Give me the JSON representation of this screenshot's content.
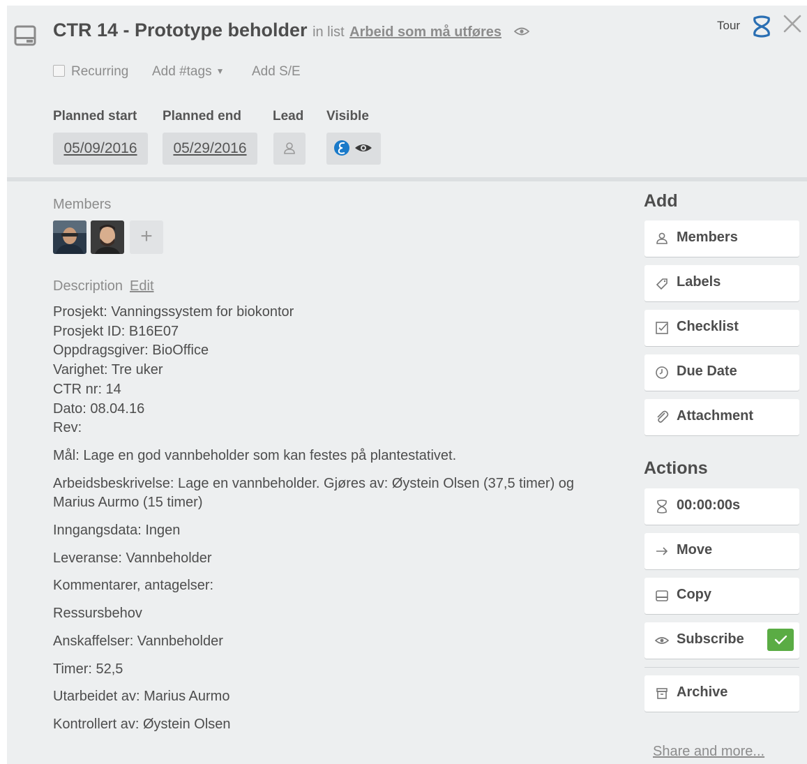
{
  "header": {
    "title": "CTR 14 - Prototype beholder",
    "in_list_prefix": "in list",
    "list_name": "Arbeid som må utføres",
    "tour_label": "Tour",
    "icons": {
      "card": "card-icon",
      "watch": "eye-icon",
      "tour": "tour-logo-icon",
      "close": "close-icon"
    },
    "recurring_label": "Recurring",
    "recurring_checked": false,
    "add_tags_label": "Add #tags",
    "add_se_label": "Add S/E"
  },
  "fields": {
    "planned_start_label": "Planned start",
    "planned_start_value": "05/09/2016",
    "planned_end_label": "Planned end",
    "planned_end_value": "05/29/2016",
    "lead_label": "Lead",
    "visible_label": "Visible"
  },
  "members": {
    "label": "Members",
    "avatars": [
      "member-avatar-1",
      "member-avatar-2"
    ],
    "add_label": "+"
  },
  "description": {
    "label": "Description",
    "edit_label": "Edit",
    "lines": [
      "Prosjekt: Vanningssystem for biokontor",
      "Prosjekt ID: B16E07",
      "Oppdragsgiver: BioOffice",
      "Varighet: Tre uker",
      "CTR nr: 14",
      "Dato: 08.04.16",
      "Rev:"
    ],
    "paragraphs": [
      "Mål: Lage en god vannbeholder som kan festes på plantestativet.",
      "Arbeidsbeskrivelse: Lage en vannbeholder. Gjøres av: Øystein Olsen (37,5 timer) og Marius Aurmo (15 timer)",
      "Inngangsdata: Ingen",
      "Leveranse: Vannbeholder",
      "Kommentarer, antagelser:",
      "Ressursbehov",
      "Anskaffelser: Vannbeholder",
      "Timer: 52,5",
      "Utarbeidet av: Marius Aurmo",
      "Kontrollert av: Øystein Olsen"
    ]
  },
  "sidebar": {
    "add_heading": "Add",
    "add_buttons": [
      {
        "label": "Members",
        "icon": "person-icon"
      },
      {
        "label": "Labels",
        "icon": "tag-icon"
      },
      {
        "label": "Checklist",
        "icon": "checklist-icon"
      },
      {
        "label": "Due Date",
        "icon": "clock-icon"
      },
      {
        "label": "Attachment",
        "icon": "paperclip-icon"
      }
    ],
    "actions_heading": "Actions",
    "action_buttons": [
      {
        "label": "00:00:00s",
        "icon": "timer-icon"
      },
      {
        "label": "Move",
        "icon": "arrow-right-icon"
      },
      {
        "label": "Copy",
        "icon": "card-icon"
      },
      {
        "label": "Subscribe",
        "icon": "eye-icon",
        "subscribed": true
      },
      {
        "label": "Archive",
        "icon": "archive-icon"
      }
    ],
    "share_label": "Share and more..."
  },
  "colors": {
    "background": "#edeff0",
    "button": "#ffffff",
    "subscribe_check": "#5aac44",
    "visibility_badge": "#1a7ac9",
    "tour_logo": "#2a6fb3"
  }
}
